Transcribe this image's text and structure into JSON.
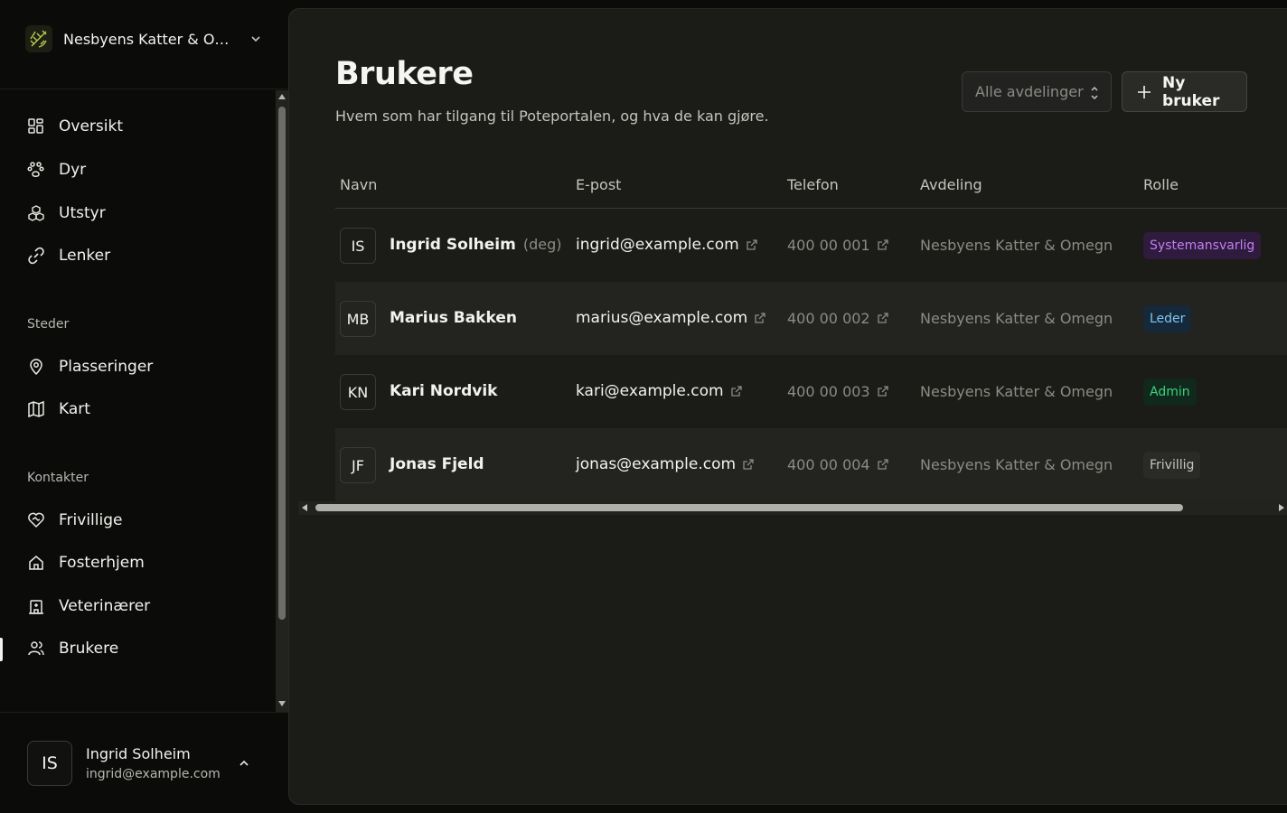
{
  "org": {
    "name": "Nesbyens Katter & Omegn",
    "logo_icon": "paw-leaf-logo"
  },
  "nav": {
    "main": [
      {
        "label": "Oversikt",
        "icon": "grid-icon"
      },
      {
        "label": "Dyr",
        "icon": "paw-icon"
      },
      {
        "label": "Utstyr",
        "icon": "boxes-icon"
      },
      {
        "label": "Lenker",
        "icon": "link-icon"
      }
    ],
    "places_section": "Steder",
    "places": [
      {
        "label": "Plasseringer",
        "icon": "map-pin-icon"
      },
      {
        "label": "Kart",
        "icon": "map-icon"
      }
    ],
    "contacts_section": "Kontakter",
    "contacts": [
      {
        "label": "Frivillige",
        "icon": "heart-handshake-icon"
      },
      {
        "label": "Fosterhjem",
        "icon": "home-icon"
      },
      {
        "label": "Veterinærer",
        "icon": "hospital-icon"
      },
      {
        "label": "Brukere",
        "icon": "users-icon",
        "active": true
      }
    ]
  },
  "current_user": {
    "initials": "IS",
    "name": "Ingrid Solheim",
    "email": "ingrid@example.com"
  },
  "page": {
    "title": "Brukere",
    "subtitle": "Hvem som har tilgang til Poteportalen, og hva de kan gjøre.",
    "dept_filter_placeholder": "Alle avdelinger",
    "new_user_label": "Ny bruker"
  },
  "table": {
    "columns": [
      "Navn",
      "E-post",
      "Telefon",
      "Avdeling",
      "Rolle"
    ],
    "rows": [
      {
        "initials": "IS",
        "name": "Ingrid Solheim",
        "self_tag": "(deg)",
        "email": "ingrid@example.com",
        "phone": "400 00 001",
        "department": "Nesbyens Katter & Omegn",
        "role": "Systemansvarlig",
        "role_color": "#c47ef2"
      },
      {
        "initials": "MB",
        "name": "Marius Bakken",
        "self_tag": "",
        "email": "marius@example.com",
        "phone": "400 00 002",
        "department": "Nesbyens Katter & Omegn",
        "role": "Leder",
        "role_color": "#7fc6f2"
      },
      {
        "initials": "KN",
        "name": "Kari Nordvik",
        "self_tag": "",
        "email": "kari@example.com",
        "phone": "400 00 003",
        "department": "Nesbyens Katter & Omegn",
        "role": "Admin",
        "role_color": "#38d47b"
      },
      {
        "initials": "JF",
        "name": "Jonas Fjeld",
        "self_tag": "",
        "email": "jonas@example.com",
        "phone": "400 00 004",
        "department": "Nesbyens Katter & Omegn",
        "role": "Frivillig",
        "role_color": "#c4c4bf"
      }
    ]
  }
}
